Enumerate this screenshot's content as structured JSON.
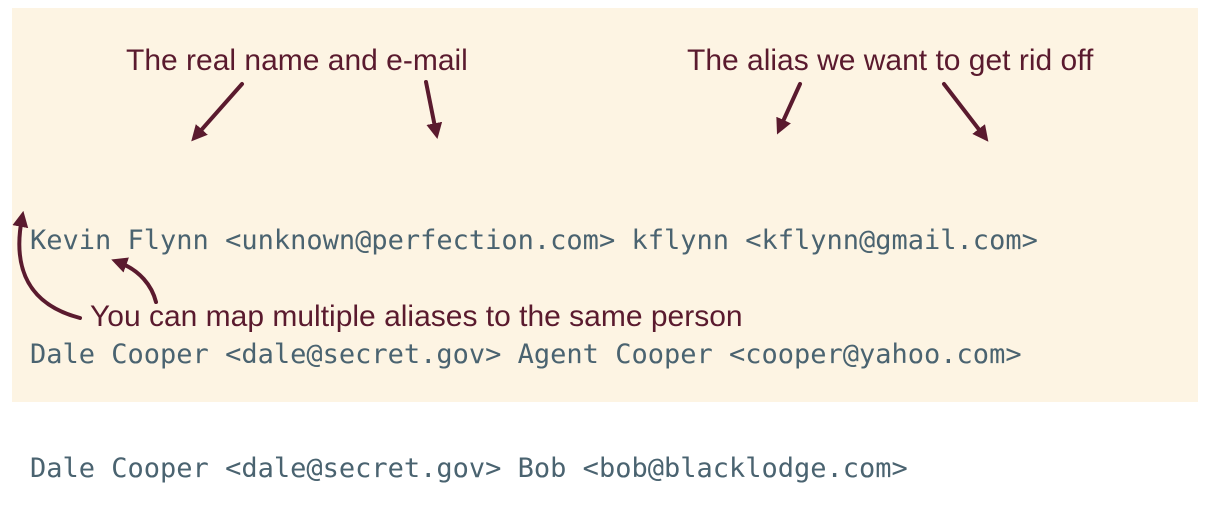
{
  "annotations": {
    "real_name_email": "The real name and e-mail",
    "alias_remove": "The alias we want to get rid off",
    "map_multiple": "You can map multiple aliases to the same person"
  },
  "mailmap_lines": [
    "Kevin Flynn <unknown@perfection.com> kflynn <kflynn@gmail.com>",
    "Dale Cooper <dale@secret.gov> Agent Cooper <cooper@yahoo.com>",
    "Dale Cooper <dale@secret.gov> Bob <bob@blacklodge.com>"
  ],
  "colors": {
    "background": "#fdf4e3",
    "annotation": "#5a1a2e",
    "code": "#4a6370"
  }
}
